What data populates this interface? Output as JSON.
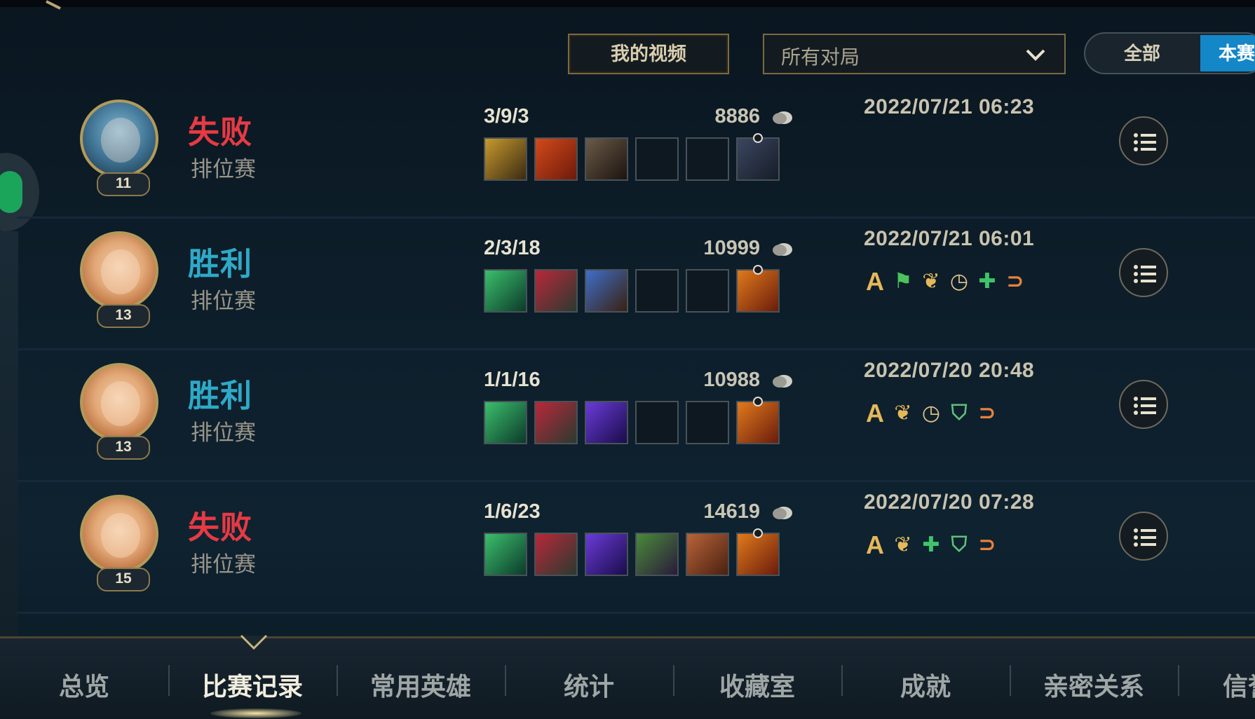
{
  "filters": {
    "my_videos_label": "我的视频",
    "match_filter_value": "所有对局",
    "toggle_all": "全部",
    "toggle_season": "本赛"
  },
  "matches": [
    {
      "result": "失败",
      "result_type": "loss",
      "mode": "排位赛",
      "level": "11",
      "kda": "3/9/3",
      "gold": "8886",
      "date": "2022/07/21 06:23",
      "badges": []
    },
    {
      "result": "胜利",
      "result_type": "win",
      "mode": "排位赛",
      "level": "13",
      "kda": "2/3/18",
      "gold": "10999",
      "date": "2022/07/21 06:01",
      "badges": [
        "A",
        "flag",
        "vine",
        "clock",
        "heal",
        "link"
      ]
    },
    {
      "result": "胜利",
      "result_type": "win",
      "mode": "排位赛",
      "level": "13",
      "kda": "1/1/16",
      "gold": "10988",
      "date": "2022/07/20 20:48",
      "badges": [
        "A",
        "vine",
        "clock",
        "shield",
        "link"
      ]
    },
    {
      "result": "失败",
      "result_type": "loss",
      "mode": "排位赛",
      "level": "15",
      "kda": "1/6/23",
      "gold": "14619",
      "date": "2022/07/20 07:28",
      "badges": [
        "A",
        "vine",
        "heal",
        "shield",
        "link"
      ]
    }
  ],
  "bottom_nav": {
    "tabs": [
      "总览",
      "比赛记录",
      "常用英雄",
      "统计",
      "收藏室",
      "成就",
      "亲密关系",
      "信誉"
    ],
    "active_index": 1
  },
  "colors": {
    "loss": "#e63a44",
    "win": "#2fa9c8",
    "gold_border": "#b39a5a",
    "toggle_active": "#1487c8"
  }
}
